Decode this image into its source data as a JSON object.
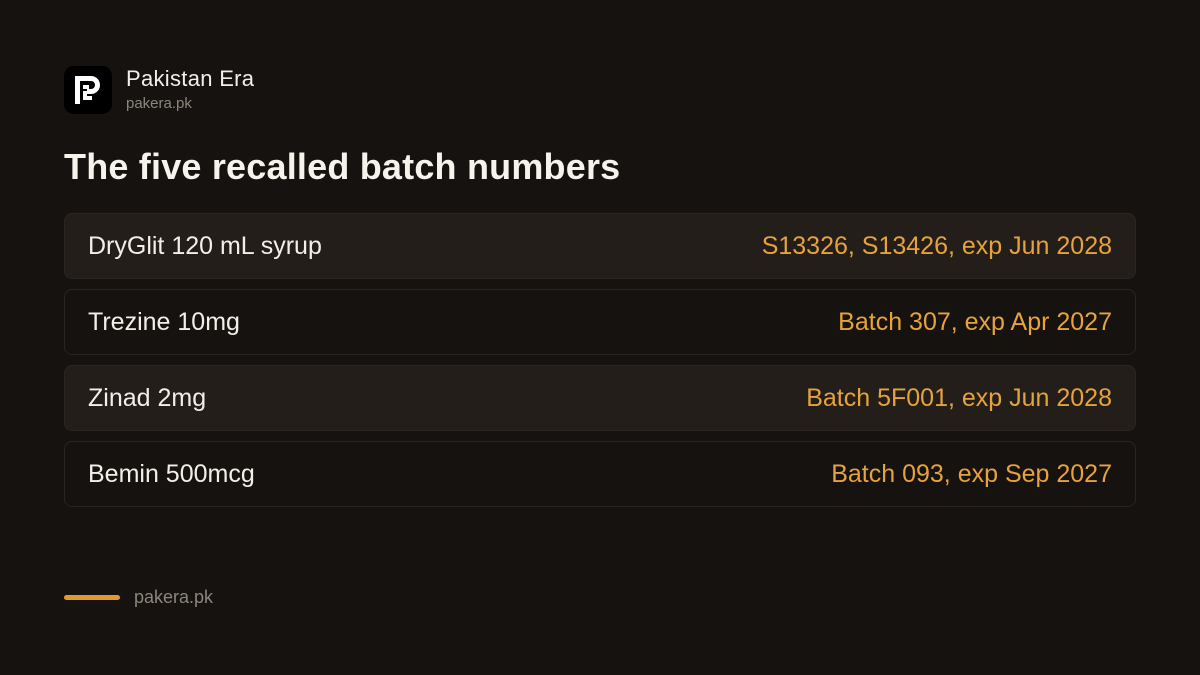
{
  "brand": {
    "name": "Pakistan Era",
    "domain": "pakera.pk",
    "logo_icon": "pe-monogram-logo"
  },
  "title": "The five recalled batch numbers",
  "items": [
    {
      "name": "DryGlit 120 mL syrup",
      "batch": "S13326, S13426, exp Jun 2028"
    },
    {
      "name": "Trezine 10mg",
      "batch": "Batch 307, exp Apr 2027"
    },
    {
      "name": "Zinad 2mg",
      "batch": "Batch 5F001, exp Jun 2028"
    },
    {
      "name": "Bemin 500mcg",
      "batch": "Batch 093, exp Sep 2027"
    }
  ],
  "footer": {
    "text": "pakera.pk"
  },
  "colors": {
    "background": "#16120f",
    "accent": "#e6a23c",
    "row_shaded": "#231e19"
  }
}
